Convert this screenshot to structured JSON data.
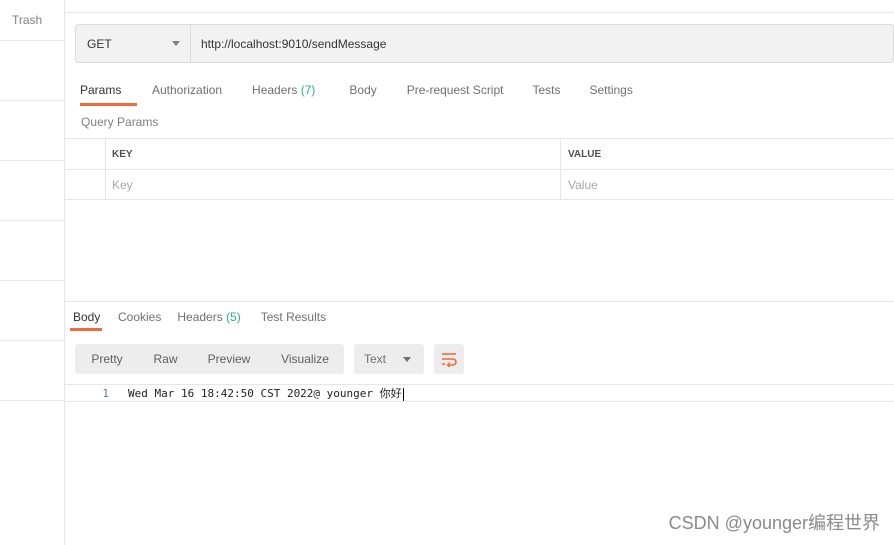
{
  "sidebar": {
    "trash_label": "Trash"
  },
  "request": {
    "method": "GET",
    "url": "http://localhost:9010/sendMessage"
  },
  "request_tabs": [
    {
      "label": "Params",
      "active": true
    },
    {
      "label": "Authorization"
    },
    {
      "label": "Headers",
      "count": "(7)"
    },
    {
      "label": "Body"
    },
    {
      "label": "Pre-request Script"
    },
    {
      "label": "Tests"
    },
    {
      "label": "Settings"
    }
  ],
  "query_params": {
    "title": "Query Params",
    "key_header": "KEY",
    "value_header": "VALUE",
    "key_placeholder": "Key",
    "value_placeholder": "Value"
  },
  "response_tabs": [
    {
      "label": "Body",
      "active": true
    },
    {
      "label": "Cookies"
    },
    {
      "label": "Headers",
      "count": "(5)"
    },
    {
      "label": "Test Results"
    }
  ],
  "response_view": {
    "modes": [
      "Pretty",
      "Raw",
      "Preview",
      "Visualize"
    ],
    "format": "Text"
  },
  "response_body": {
    "line_number": "1",
    "line_text": "Wed Mar 16 18:42:50 CST 2022@ younger 你好"
  },
  "watermark": "CSDN @younger编程世界",
  "colors": {
    "accent": "#f26b3a",
    "count": "#26b47f"
  },
  "icons": {
    "wrap": "wrap-lines-icon",
    "dropdown": "chevron-down-icon"
  }
}
